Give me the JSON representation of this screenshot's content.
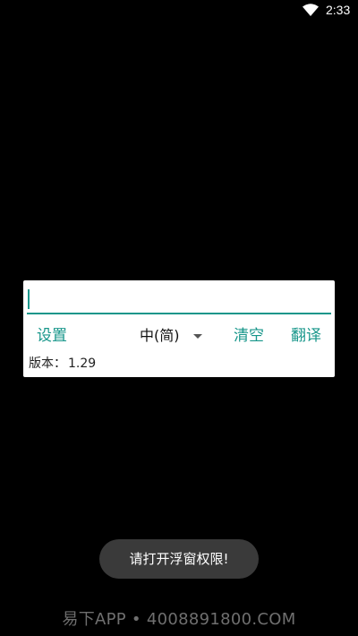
{
  "status_bar": {
    "time": "2:33",
    "wifi_icon": "wifi-icon"
  },
  "card": {
    "input_value": "",
    "settings_label": "设置",
    "language_label": "中(简)",
    "clear_label": "清空",
    "translate_label": "翻译",
    "version_label": "版本：",
    "version_value": "1.29"
  },
  "toast": {
    "message": "请打开浮窗权限!"
  },
  "watermark": {
    "text": "易下APP • 4008891800.COM"
  },
  "colors": {
    "accent": "#17968a",
    "background": "#000000",
    "card": "#ffffff",
    "toast_bg": "#3a3a3a"
  }
}
